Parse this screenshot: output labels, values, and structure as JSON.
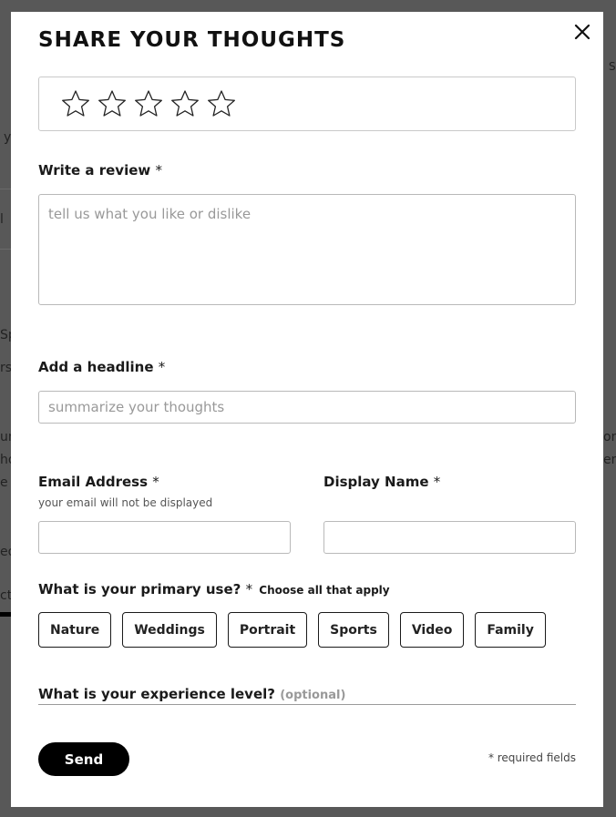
{
  "background": {
    "fragments": [
      "S",
      "y",
      "l",
      "Sp",
      "rs",
      "un",
      "ho",
      "e",
      "on",
      "em",
      "ed",
      "ct"
    ]
  },
  "modal": {
    "title": "SHARE YOUR THOUGHTS",
    "close_icon": "close-icon",
    "rating": {
      "stars_total": 5,
      "stars_selected": 0
    },
    "review": {
      "label": "Write a review",
      "required_mark": "*",
      "placeholder": "tell us what you like or dislike",
      "value": ""
    },
    "headline": {
      "label": "Add a headline",
      "required_mark": "*",
      "placeholder": "summarize your thoughts",
      "value": ""
    },
    "email": {
      "label": "Email Address",
      "required_mark": "*",
      "hint": "your email will not be displayed",
      "value": ""
    },
    "display_name": {
      "label": "Display Name",
      "required_mark": "*",
      "value": ""
    },
    "primary_use": {
      "label": "What is your primary use?",
      "required_mark": "*",
      "hint": "Choose all that apply",
      "options": [
        "Nature",
        "Weddings",
        "Portrait",
        "Sports",
        "Video",
        "Family"
      ]
    },
    "experience": {
      "label": "What is your experience level?",
      "optional_note": "(optional)"
    },
    "send_label": "Send",
    "required_note": "* required fields"
  },
  "colors": {
    "overlay": "#585858",
    "modal_bg": "#ffffff",
    "button_bg": "#000000",
    "border": "#b9b9b9"
  }
}
